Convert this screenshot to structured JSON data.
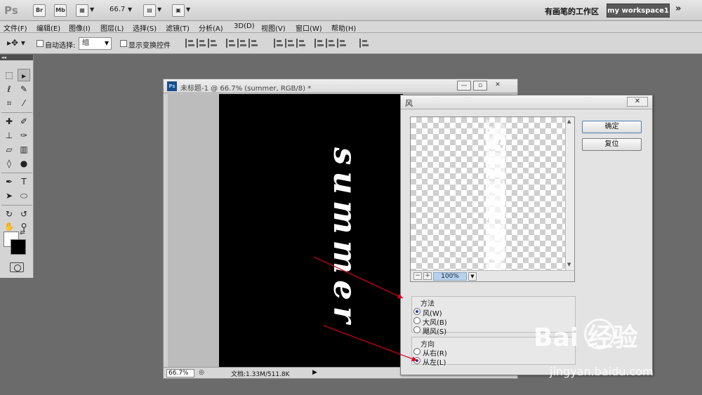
{
  "app": {
    "logo": "Ps",
    "bridge_btn": "Br",
    "minibridge_btn": "Mb",
    "zoom_value": "66.7",
    "workspace_label": "有画笔的工作区",
    "workspace_button": "my workspace1",
    "more": "»"
  },
  "menu": {
    "items": [
      "文件(F)",
      "编辑(E)",
      "图像(I)",
      "图层(L)",
      "选择(S)",
      "滤镜(T)",
      "分析(A)",
      "3D(D)",
      "视图(V)",
      "窗口(W)",
      "帮助(H)"
    ]
  },
  "options": {
    "auto_select_label": "自动选择:",
    "auto_select_value": "组",
    "show_transform_label": "显示变换控件"
  },
  "tools_panel": {
    "collapse_label": "◂◂"
  },
  "document": {
    "badge": "Ps",
    "title": "未标题-1 @ 66.7% (summer, RGB/8) *",
    "canvas_text": "summer",
    "zoom_field": "66.7%",
    "status_text": "文档:1.33M/511.8K",
    "btn_min": "—",
    "btn_restore": "▫",
    "btn_close": "✕"
  },
  "dialog": {
    "title": "风",
    "close": "✕",
    "ok_button": "确定",
    "reset_button": "复位",
    "preview_zoom": "100%",
    "preview_text": "summer",
    "method": {
      "title": "方法",
      "options": [
        "风(W)",
        "大风(B)",
        "飓风(S)"
      ],
      "selected": 0
    },
    "direction": {
      "title": "方向",
      "options": [
        "从右(R)",
        "从左(L)"
      ],
      "selected": 1
    }
  },
  "annotation": {
    "arrow_color": "#e0001a"
  },
  "watermark": {
    "logo": "Bai  经验",
    "url": "jingyan.baidu.com"
  }
}
